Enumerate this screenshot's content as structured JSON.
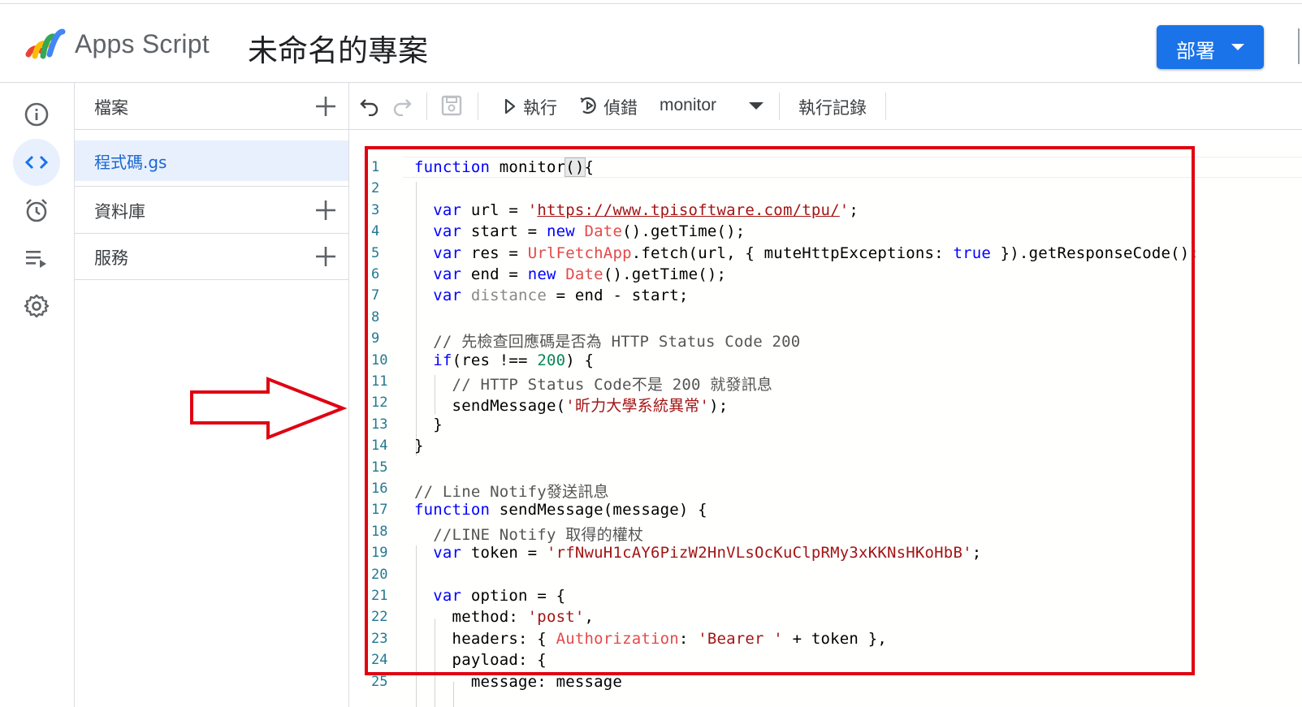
{
  "header": {
    "brand": "Apps Script",
    "project_title": "未命名的專案",
    "deploy_label": "部署"
  },
  "rail": {
    "items": [
      {
        "icon": "info-icon",
        "active": false
      },
      {
        "icon": "code-icon",
        "active": true
      },
      {
        "icon": "alarm-clock-icon",
        "active": false
      },
      {
        "icon": "executions-icon",
        "active": false
      },
      {
        "icon": "gear-icon",
        "active": false
      }
    ]
  },
  "files": {
    "files_label": "檔案",
    "active_file": "程式碼.gs",
    "libraries_label": "資料庫",
    "services_label": "服務"
  },
  "toolbar": {
    "run_label": "執行",
    "debug_label": "偵錯",
    "function_select": "monitor",
    "log_label": "執行記錄"
  },
  "editor": {
    "line_numbers": [
      "1",
      "2",
      "3",
      "4",
      "5",
      "6",
      "7",
      "8",
      "9",
      "10",
      "11",
      "12",
      "13",
      "14",
      "15",
      "16",
      "17",
      "18",
      "19",
      "20",
      "21",
      "22",
      "23",
      "24",
      "25"
    ],
    "lines": [
      "function monitor(){",
      "",
      "  var url = 'https://www.tpisoftware.com/tpu/';",
      "  var start = new Date().getTime();",
      "  var res = UrlFetchApp.fetch(url, { muteHttpExceptions: true }).getResponseCode();",
      "  var end = new Date().getTime();",
      "  var distance = end - start;",
      "",
      "  // 先檢查回應碼是否為 HTTP Status Code 200",
      "  if(res !== 200) {",
      "    // HTTP Status Code不是 200 就發訊息",
      "    sendMessage('昕力大學系統異常');",
      "  }",
      "}",
      "",
      "// Line Notify發送訊息",
      "function sendMessage(message) {",
      "  //LINE Notify 取得的權杖",
      "  var token = 'rfNwuH1cAY6PizW2HnVLsOcKuClpRMy3xKKNsHKoHbB';",
      "",
      "  var option = {",
      "    method: 'post',",
      "    headers: { Authorization: 'Bearer ' + token },",
      "    payload: {",
      "      message: message"
    ]
  },
  "colors": {
    "accent": "#1a73e8",
    "annotation_red": "#e00012"
  }
}
